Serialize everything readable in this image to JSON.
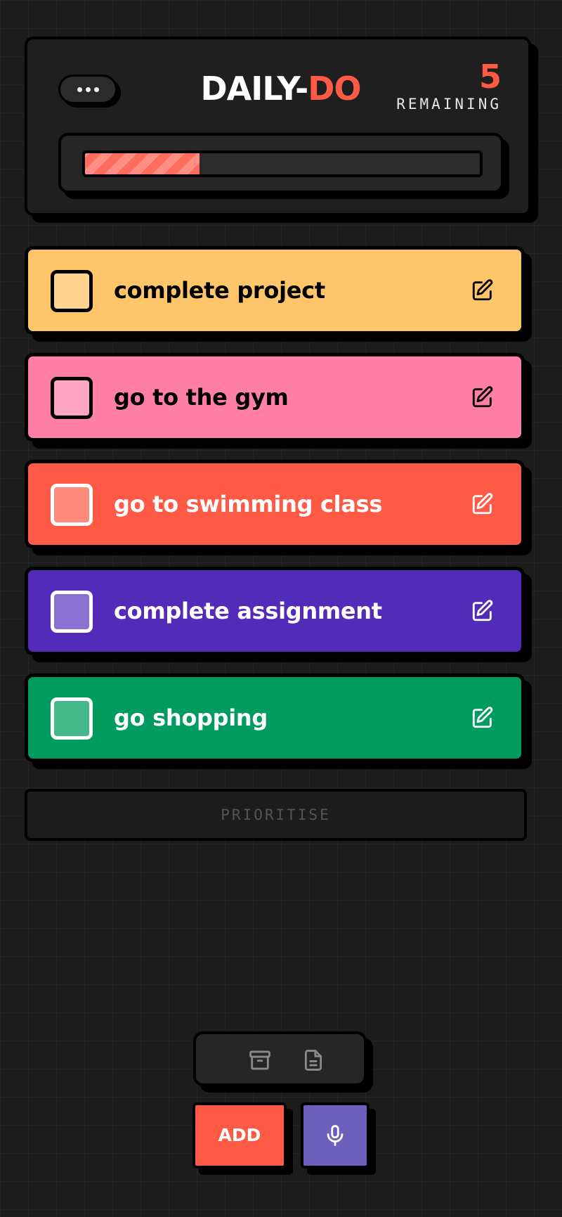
{
  "header": {
    "title_main": "DAILY-",
    "title_accent": "DO",
    "remaining_count": "5",
    "remaining_label": "REMAINING",
    "progress_fraction": 0.29,
    "menu_icon": "more-horizontal-icon"
  },
  "tasks": [
    {
      "label": "complete project",
      "bg": "#ffc56b",
      "checkbox_fill": "#ffd48e",
      "checkbox_border": "#000000",
      "text_color": "#000000"
    },
    {
      "label": "go to the gym",
      "bg": "#ff7fa7",
      "checkbox_fill": "#ffa4c2",
      "checkbox_border": "#000000",
      "text_color": "#000000"
    },
    {
      "label": "go to swimming class",
      "bg": "#ff5a45",
      "checkbox_fill": "#ff8a7c",
      "checkbox_border": "#ffffff",
      "text_color": "#ffffff"
    },
    {
      "label": "complete assignment",
      "bg": "#532bb9",
      "checkbox_fill": "#8a70d0",
      "checkbox_border": "#ffffff",
      "text_color": "#ffffff"
    },
    {
      "label": "go shopping",
      "bg": "#009b5e",
      "checkbox_fill": "#45b88a",
      "checkbox_border": "#ffffff",
      "text_color": "#ffffff"
    }
  ],
  "prioritise": {
    "label": "PRIORITISE"
  },
  "toolbar": {
    "add_label": "ADD",
    "archive_icon": "archive-icon",
    "notes_icon": "notes-icon",
    "mic_icon": "mic-icon"
  },
  "colors": {
    "accent": "#ff5a45",
    "background": "#1c1c1c",
    "mic_button": "#6d5fbc"
  }
}
